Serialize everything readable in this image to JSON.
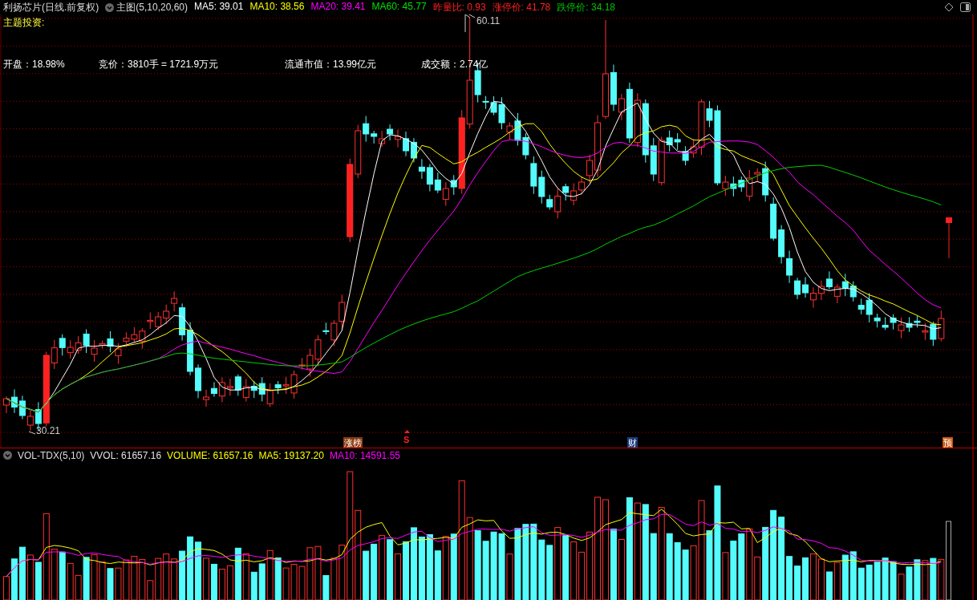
{
  "header": {
    "title": "利扬芯片(日线.前复权)",
    "menu": "主图(5,10,20,60)",
    "indicators": [
      {
        "label": "MA5: 39.01",
        "color": "#ffffff"
      },
      {
        "label": "MA10: 38.56",
        "color": "#ffff00"
      },
      {
        "label": "MA20: 39.41",
        "color": "#ff00ff"
      },
      {
        "label": "MA60: 45.77",
        "color": "#00e000"
      },
      {
        "label": "昨量比: 0.93",
        "color": "#ff2020"
      },
      {
        "label": "涨停价: 41.78",
        "color": "#ff2020"
      },
      {
        "label": "跌停价: 34.18",
        "color": "#00c000"
      }
    ]
  },
  "price_panel": {
    "theme_label": "主题投资:",
    "info": [
      "开盘：18.98%",
      "竞价：3810手 = 1721.9万元",
      "流通市值：13.99亿元",
      "成交额：2.74亿"
    ],
    "high_label": "60.11",
    "low_label": "30.21",
    "markers": [
      {
        "text": "涨榜",
        "kind": "tag",
        "color": "#8b3a10"
      },
      {
        "text": "S",
        "kind": "signal",
        "color": "#ff2020"
      },
      {
        "text": "财",
        "kind": "tag",
        "color": "#1a3a7a"
      },
      {
        "text": "预",
        "kind": "tag",
        "color": "#c85a10"
      }
    ]
  },
  "volume_panel": {
    "name": "VOL-TDX(5,10)",
    "indicators": [
      {
        "label": "VVOL: 61657.16",
        "color": "#e0e0e0"
      },
      {
        "label": "VOLUME: 61657.16",
        "color": "#ffff00"
      },
      {
        "label": "MA5: 19137.20",
        "color": "#ffff00"
      },
      {
        "label": "MA10: 14591.55",
        "color": "#ff00ff"
      }
    ]
  }
}
